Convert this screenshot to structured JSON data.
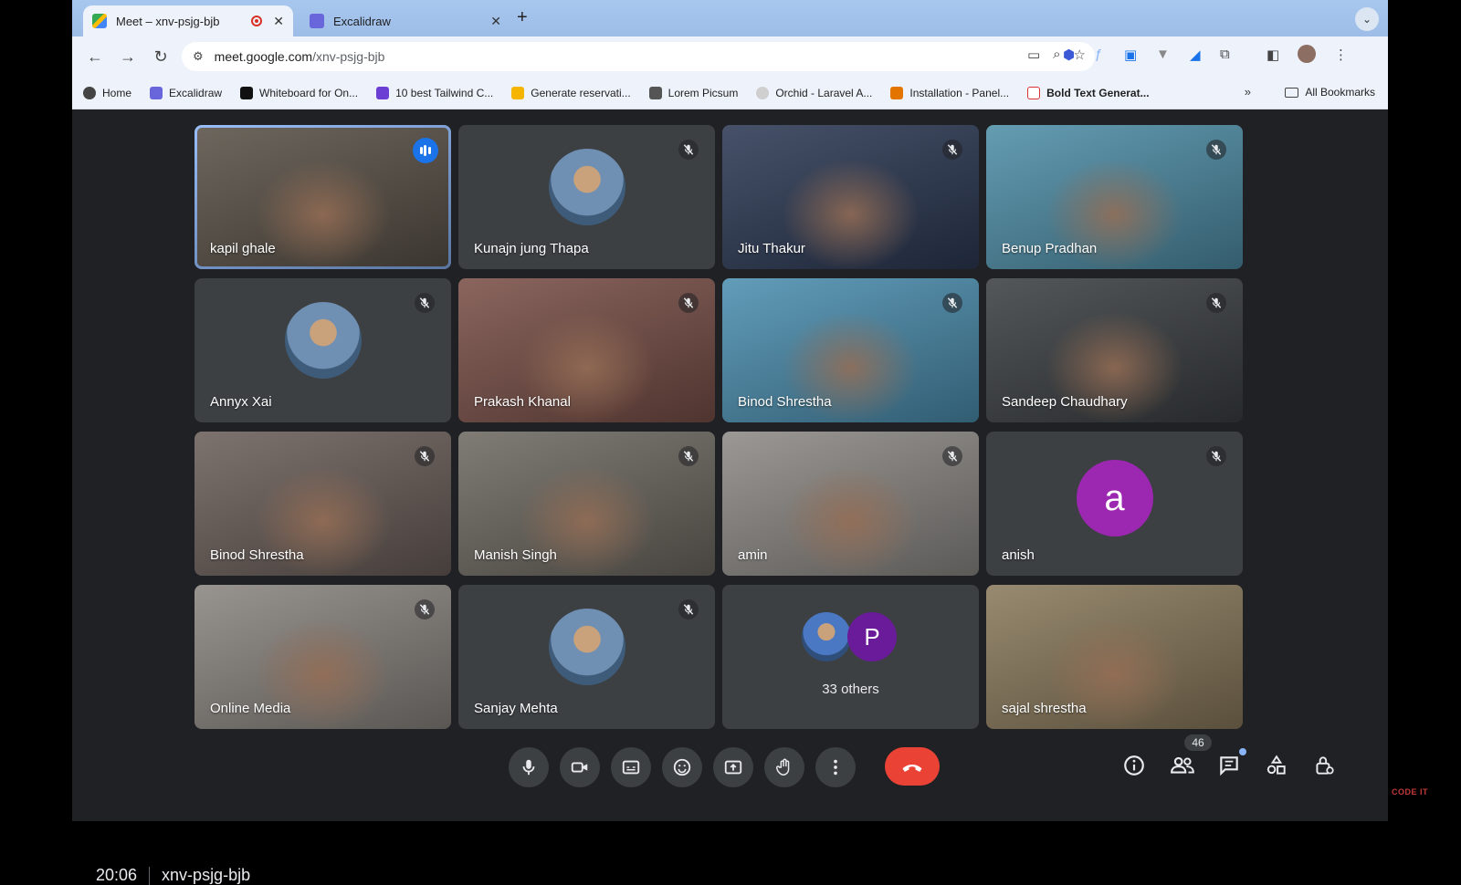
{
  "browser": {
    "tabs": [
      {
        "title": "Meet – xnv-psjg-bjb",
        "active": true,
        "recording": true
      },
      {
        "title": "Excalidraw",
        "active": false
      }
    ],
    "url": {
      "host": "meet.google.com",
      "path": "/xnv-psjg-bjb"
    },
    "bookmarks": [
      {
        "label": "Home",
        "color": "#444444"
      },
      {
        "label": "Excalidraw",
        "color": "#6965db"
      },
      {
        "label": "Whiteboard for On...",
        "color": "#111111"
      },
      {
        "label": "10 best Tailwind C...",
        "color": "#6b3fd4"
      },
      {
        "label": "Generate reservati...",
        "color": "#f4b400"
      },
      {
        "label": "Lorem Picsum",
        "color": "#555555"
      },
      {
        "label": "Orchid - Laravel A...",
        "color": "#cfcfcf"
      },
      {
        "label": "Installation - Panel...",
        "color": "#e37400"
      },
      {
        "label": "Bold Text Generat...",
        "color": "#d9d9d9"
      }
    ],
    "all_bookmarks_label": "All Bookmarks"
  },
  "meet": {
    "participants": [
      {
        "name": "kapil ghale",
        "speaking": true,
        "bg": "#5a5248"
      },
      {
        "name": "Kunajn jung Thapa",
        "avatar": true,
        "bg": "#3c4043"
      },
      {
        "name": "Jitu Thakur",
        "bg": "#2d3a55"
      },
      {
        "name": "Benup Pradhan",
        "bg": "#4f8fa8"
      },
      {
        "name": "Annyx Xai",
        "avatar": true,
        "bg": "#3c4043"
      },
      {
        "name": "Prakash Khanal",
        "bg": "#7a5048"
      },
      {
        "name": "Binod Shrestha",
        "bg": "#4c8fb0"
      },
      {
        "name": "Sandeep Chaudhary",
        "bg": "#3c4043"
      },
      {
        "name": "Binod Shrestha",
        "bg": "#6b5f5a"
      },
      {
        "name": "Manish Singh",
        "bg": "#6e6a62"
      },
      {
        "name": "amin",
        "bg": "#8d8a86"
      },
      {
        "name": "anish",
        "letter": "a",
        "bg": "#3c4043"
      },
      {
        "name": "Online Media",
        "bg": "#8a8580"
      },
      {
        "name": "Sanjay Mehta",
        "avatar": true,
        "bg": "#3c4043"
      },
      {
        "name": "",
        "others": true,
        "bg": "#3c4043"
      },
      {
        "name": "sajal shrestha",
        "bg": "#8a7a5c"
      }
    ],
    "others_label": "33 others",
    "others_letter": "P",
    "time": "20:06",
    "meeting_code": "xnv-psjg-bjb",
    "people_count": "46",
    "watermark": "CODE IT"
  }
}
